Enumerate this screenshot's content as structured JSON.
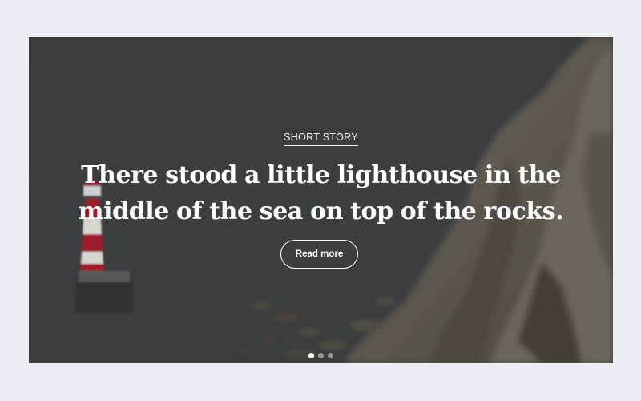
{
  "slider": {
    "category": "SHORT STORY",
    "headline": "There stood a little lighthouse in the middle of the sea on top of the rocks.",
    "cta_label": "Read more",
    "slide_count": 3,
    "active_slide": 1,
    "background_image": "lighthouse-on-rocks-by-white-cliffs"
  },
  "colors": {
    "page_background": "#eaeef4",
    "overlay": "#3b3d3f",
    "text": "#ffffff",
    "lighthouse_red": "#9e1f2c"
  }
}
